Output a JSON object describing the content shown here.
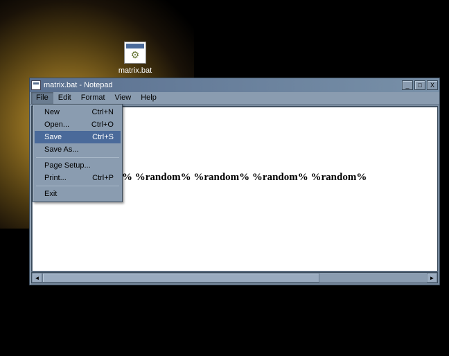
{
  "desktop": {
    "icon_label": "matrix.bat"
  },
  "window": {
    "title": "matrix.bat - Notepad",
    "controls": {
      "min": "_",
      "max": "□",
      "close": "X"
    }
  },
  "menubar": {
    "items": [
      "File",
      "Edit",
      "Format",
      "View",
      "Help"
    ],
    "active_index": 0
  },
  "file_menu": {
    "items": [
      {
        "label": "New",
        "shortcut": "Ctrl+N",
        "highlight": false
      },
      {
        "label": "Open...",
        "shortcut": "Ctrl+O",
        "highlight": false
      },
      {
        "label": "Save",
        "shortcut": "Ctrl+S",
        "highlight": true
      },
      {
        "label": "Save As...",
        "shortcut": "",
        "highlight": false
      },
      {
        "sep": true
      },
      {
        "label": "Page Setup...",
        "shortcut": "",
        "highlight": false
      },
      {
        "label": "Print...",
        "shortcut": "Ctrl+P",
        "highlight": false
      },
      {
        "sep": true
      },
      {
        "label": "Exit",
        "shortcut": "",
        "highlight": false
      }
    ]
  },
  "editor": {
    "content": "% %random% %random% %random% %random%"
  },
  "scroll": {
    "left_arrow": "◄",
    "right_arrow": "►"
  }
}
